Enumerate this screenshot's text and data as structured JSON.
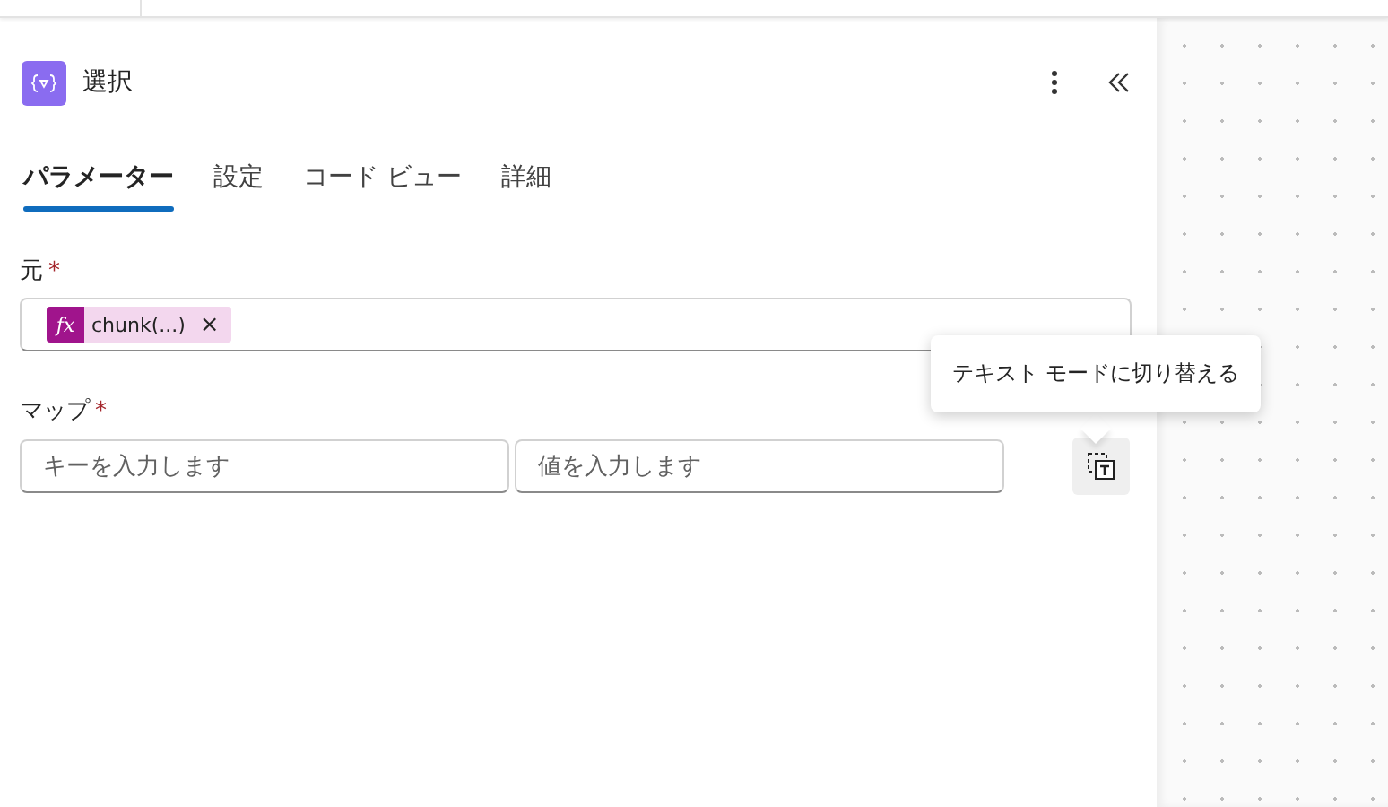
{
  "header": {
    "title": "選択"
  },
  "tabs": [
    {
      "label": "パラメーター",
      "selected": true
    },
    {
      "label": "設定",
      "selected": false
    },
    {
      "label": "コード ビュー",
      "selected": false
    },
    {
      "label": "詳細",
      "selected": false
    }
  ],
  "source": {
    "label": "元",
    "required_mark": "*",
    "token": {
      "icon": "fx",
      "text": "chunk(...)",
      "remove": "×"
    }
  },
  "map": {
    "label": "マップ",
    "required_mark": "*",
    "key_placeholder": "キーを入力します",
    "value_placeholder": "値を入力します"
  },
  "tooltip": {
    "text": "テキスト モードに切り替える"
  }
}
